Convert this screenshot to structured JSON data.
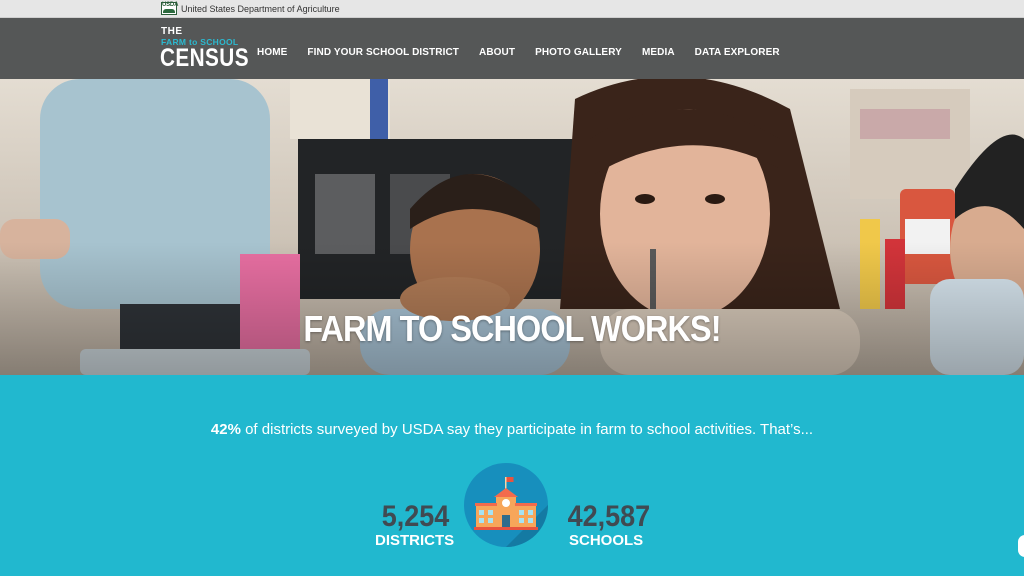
{
  "usda": {
    "logo_text": "USDA",
    "department": "United States Department of Agriculture"
  },
  "logo": {
    "line1": "THE",
    "line2": "FARM to SCHOOL",
    "line3": "CENSUS"
  },
  "nav": {
    "items": [
      {
        "label": "HOME"
      },
      {
        "label": "FIND YOUR SCHOOL DISTRICT"
      },
      {
        "label": "ABOUT"
      },
      {
        "label": "PHOTO GALLERY"
      },
      {
        "label": "MEDIA"
      },
      {
        "label": "DATA EXPLORER"
      }
    ]
  },
  "hero": {
    "title": "FARM TO SCHOOL WORKS!"
  },
  "stats": {
    "percent": "42%",
    "intro_rest": " of districts surveyed by USDA say they participate in farm to school activities. That’s...",
    "districts_value": "5,254",
    "districts_label": "DISTRICTS",
    "schools_value": "42,587",
    "schools_label": "SCHOOLS",
    "icon": "school-building-icon"
  },
  "colors": {
    "header_bg": "#555757",
    "accent_teal": "#21b8cf",
    "logo_accent": "#2bb9cf",
    "stat_number": "#404a52",
    "icon_circle": "#178fbd"
  }
}
